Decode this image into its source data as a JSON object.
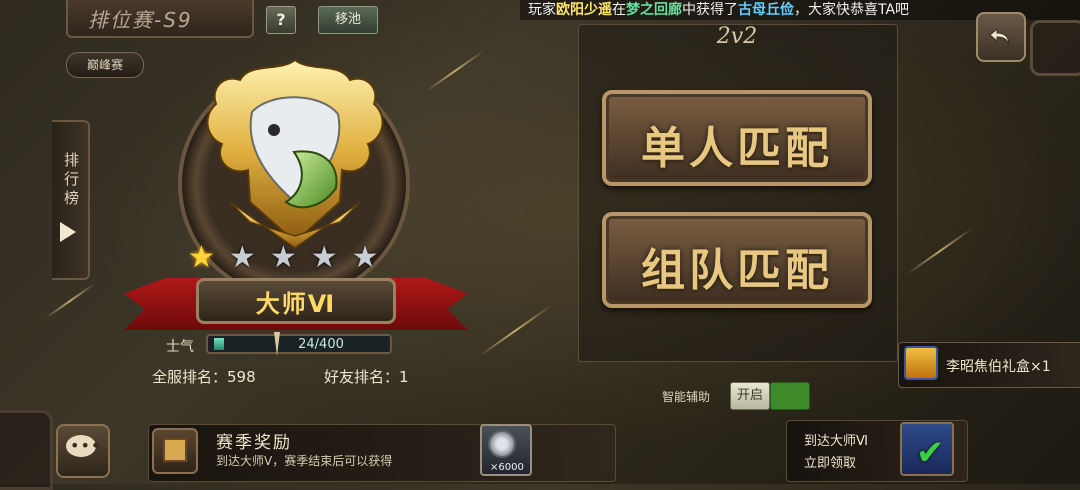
{
  "header": {
    "season_title": "排位赛-S9",
    "help_label": "?",
    "transfer_label": "移池",
    "peak_label": "巅峰赛"
  },
  "ticker": {
    "prefix": "玩家",
    "player": "欧阳少遥",
    "mid1": "在",
    "place": "梦之回廊",
    "mid2": "中获得了",
    "item": "古母丘俭",
    "suffix": "，大家快恭喜TA吧"
  },
  "sidebar": {
    "leaderboard_label": "排行榜"
  },
  "rank": {
    "name": "大师Ⅵ",
    "stars_filled": 1,
    "stars_total": 5,
    "morale_label": "士气",
    "morale_value": "24/400",
    "morale_fraction": 0.06,
    "server_rank_label": "全服排名：598",
    "friend_rank_label": "好友排名：1"
  },
  "modes": {
    "title": "2v2",
    "solo_label": "单人匹配",
    "team_label": "组队匹配"
  },
  "assist": {
    "label": "智能辅助",
    "toggle_label": "开启"
  },
  "gift": {
    "label": "李昭焦伯礼盒×1"
  },
  "reward": {
    "title": "赛季奖励",
    "desc": "到达大师Ⅴ，赛季结束后可以获得",
    "coin_count": "×6000"
  },
  "claim": {
    "line1": "到达大师Ⅵ",
    "line2": "立即领取"
  },
  "colors": {
    "accent_gold": "#ffd966",
    "ribbon_red": "#b01818",
    "toggle_green": "#3e8a2a"
  }
}
